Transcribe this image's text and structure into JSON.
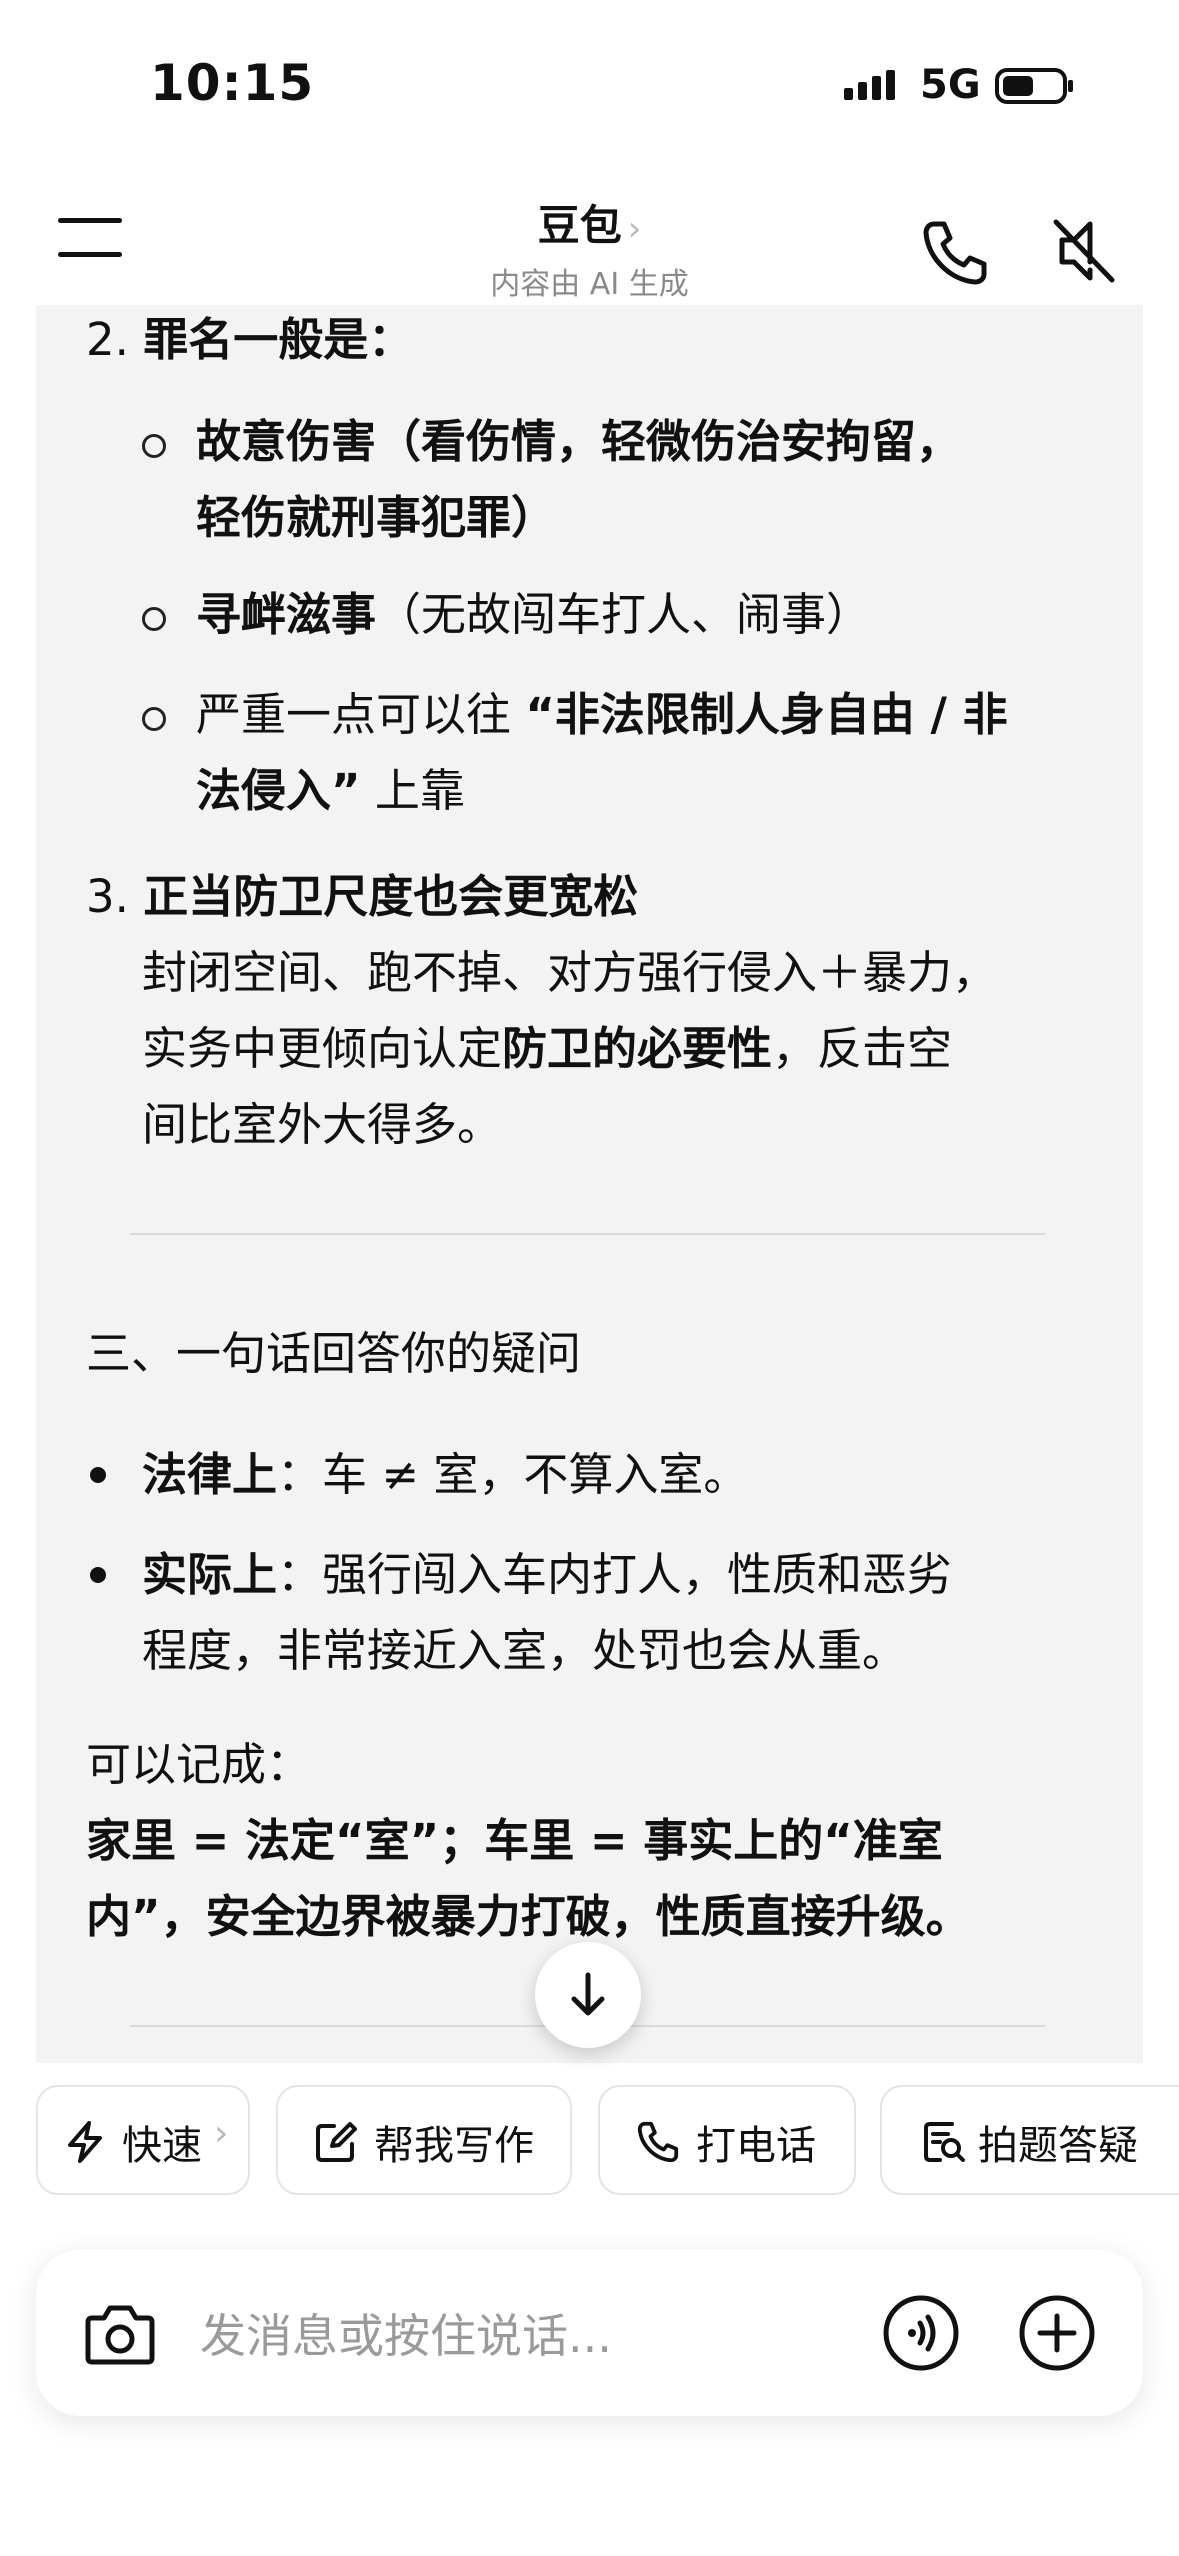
{
  "status_bar": {
    "time": "10:15",
    "network": "5G"
  },
  "header": {
    "title": "豆包",
    "title_chevron": "›",
    "subtitle": "内容由 AI 生成",
    "icons": [
      "menu-icon",
      "phone-icon",
      "mute-icon"
    ]
  },
  "message": {
    "item2": {
      "number": "2.",
      "heading": "罪名一般是：",
      "subitems": [
        {
          "bold": "故意伤害",
          "rest_line1": "（看伤情，轻微伤治安拘留，",
          "line2_bold": "轻伤就刑事犯罪",
          "line2_rest": "）"
        },
        {
          "bold": "寻衅滋事",
          "rest_line1": "（无故闯车打人、闹事）"
        },
        {
          "pre": "严重一点可以往 ",
          "bold_line1": "“非法限制人身自由 / 非",
          "bold_line2": "法侵入”",
          "post": " 上靠"
        }
      ]
    },
    "item3": {
      "number": "3.",
      "heading": "正当防卫尺度也会更宽松",
      "line1": "封闭空间、跑不掉、对方强行侵入＋暴力，",
      "line2_pre": "实务中更倾向认定",
      "line2_bold": "防卫的必要性",
      "line2_post": "，反击空",
      "line3": "间比室外大得多。"
    },
    "section3": {
      "heading": "三、一句话回答你的疑问",
      "bullets": [
        {
          "bold": "法律上",
          "text": "：车 ≠ 室，不算入室。"
        },
        {
          "bold": "实际上",
          "text_line1": "：强行闯入车内打人，性质和恶劣",
          "text_line2": "程度，非常接近入室，处罚也会从重。"
        }
      ],
      "note_label": "可以记成：",
      "summary_line1": "家里 = 法定“室”；车里 = 事实上的“准室",
      "summary_line2": "内”，安全边界被暴力打破，性质直接升级。"
    }
  },
  "scroll_button_icon": "arrow-down-icon",
  "quick_actions": [
    {
      "label": "快速",
      "icon": "lightning-icon",
      "chevron": "›"
    },
    {
      "label": "帮我写作",
      "icon": "edit-icon"
    },
    {
      "label": "打电话",
      "icon": "phone-icon"
    },
    {
      "label": "拍题答疑",
      "icon": "search-doc-icon"
    }
  ],
  "composer": {
    "placeholder": "发消息或按住说话...",
    "icons": [
      "camera-icon",
      "voice-icon",
      "plus-icon"
    ]
  },
  "colors": {
    "background": "#ffffff",
    "card": "#f3f3f4",
    "text": "#111111",
    "muted": "#8a8a8a",
    "border": "#e3e3e3"
  }
}
